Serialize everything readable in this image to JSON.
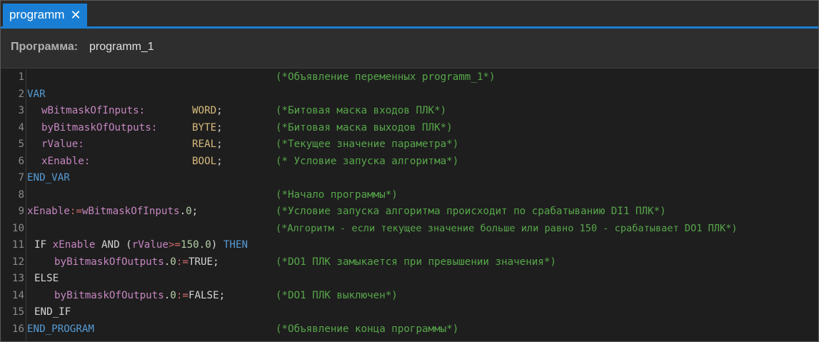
{
  "tab": {
    "title": "programm",
    "close_glyph": "✕"
  },
  "header": {
    "label": "Программа:",
    "value": "programm_1"
  },
  "editor": {
    "line_numbers": [
      "1",
      "2",
      "3",
      "4",
      "5",
      "6",
      "7",
      "8",
      "9",
      "10",
      "11",
      "12",
      "13",
      "14",
      "15",
      "16"
    ],
    "comments": [
      "(*Объявление переменных programm_1*)",
      "",
      "(*Битовая маска входов ПЛК*)",
      "(*Битовая маска выходов ПЛК*)",
      "(*Текущее значение параметра*)",
      "(* Условие запуска алгоритма*)",
      "",
      "(*Начало программы*)",
      "(*Условие запуска алгоритма происходит по срабатыванию DI1 ПЛК*)",
      "(*Алгоритм - если текущее значение больше или равно 150 - срабатывает DO1 ПЛК*)",
      "",
      "(*DO1 ПЛК замыкается при превышении значения*)",
      "",
      "(*DO1 ПЛК выключен*)",
      "",
      "(*Объявление конца программы*)"
    ],
    "tokens": {
      "l2_var": "VAR",
      "l3_name": "wBitmaskOfInputs:",
      "l3_type": "WORD",
      "l4_name": "byBitmaskOfOutputs:",
      "l4_type": "BYTE",
      "l5_name": "rValue:",
      "l5_type": "REAL",
      "l6_name": "xEnable:",
      "l6_type": "BOOL",
      "semicolon": ";",
      "l7_endvar": "END_VAR",
      "l9_a": "xEnable",
      "l9_op": ":=",
      "l9_b": "wBitmaskOfInputs",
      "l9_dot": ".",
      "l9_num": "0",
      "l9_end": ";",
      "l11_if": "IF",
      "l11_x": "xEnable",
      "l11_and": "AND",
      "l11_paren1": "(",
      "l11_r": "rValue",
      "l11_ge": ">=",
      "l11_num": "150.0",
      "l11_paren2": ")",
      "l11_then": "THEN",
      "l12_name": "byBitmaskOfOutputs",
      "l12_dot": ".",
      "l12_num": "0",
      "l12_op": ":=",
      "l12_val": "TRUE;",
      "l13_else": "ELSE",
      "l14_name": "byBitmaskOfOutputs",
      "l14_dot": ".",
      "l14_num": "0",
      "l14_op": ":=",
      "l14_val": "FALSE;",
      "l15_endif": "END_IF",
      "l16_endprog": "END_PROGRAM"
    }
  },
  "colors": {
    "accent": "#1a7fd4",
    "keyword": "#569cd6",
    "variable": "#c586c0",
    "type": "#d7ba7d",
    "comment": "#57a64a",
    "number": "#b5cea8"
  }
}
